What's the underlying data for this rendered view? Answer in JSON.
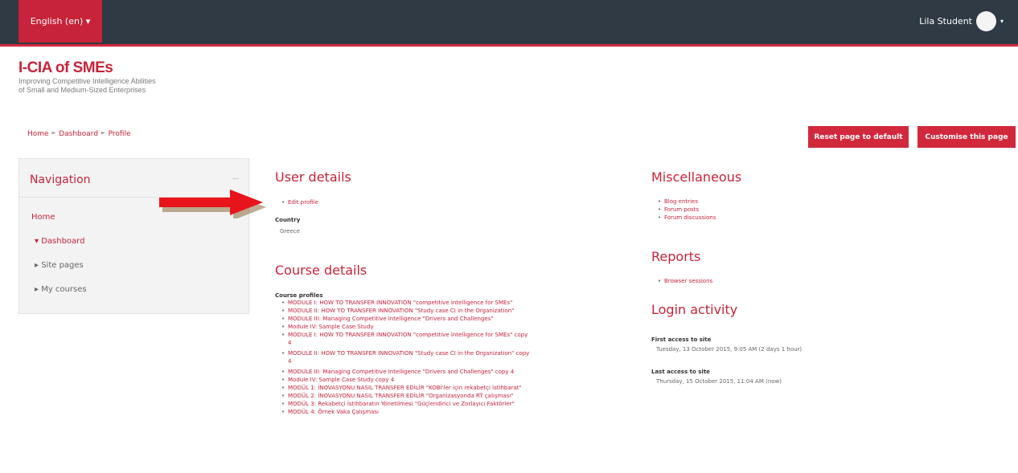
{
  "topbar": {
    "language": "English (en) ▾",
    "user_name": "Lila Student",
    "caret": "▾"
  },
  "logo": {
    "title": "I-CIA of SMEs",
    "subtitle_line1": "Improving Competitive Intelligence Abilities",
    "subtitle_line2": "of Small and Medium-Sized Enterprises"
  },
  "breadcrumb": [
    "Home",
    "►",
    "Dashboard",
    "►",
    "Profile"
  ],
  "buttons": {
    "reset": "Reset page to default",
    "customise": "Customise this page"
  },
  "navigation": {
    "title": "Navigation",
    "items": [
      "Home",
      "▾ Dashboard",
      "▸ Site pages",
      "▸ My courses"
    ]
  },
  "user_details": {
    "title": "User details",
    "edit_profile": "Edit profile",
    "country_label": "Country",
    "country_value": "Greece"
  },
  "course_details": {
    "title": "Course details",
    "profiles_label": "Course profiles",
    "courses": [
      "MODULE I: HOW TO TRANSFER INNOVATION \"competitive intelligence for SMEs\"",
      "MODULE II: HOW TO TRANSFER INNOVATION \"Study case CI in the Organization\"",
      "MODULE III: Managing Competitive Intelligence \"Drivers and Challenges\"",
      "Module IV: Sample Case Study",
      "MODULE I: HOW TO TRANSFER INNOVATION \"competitive intelligence for SMEs\" copy",
      "MODULE II: HOW TO TRANSFER INNOVATION \"Study case CI in the Organization\" copy",
      "MODULE III: Managing Competitive Intelligence \"Drivers and Challenges\" copy 4",
      "Module IV: Sample Case Study copy 4",
      "MODÜL 1: İNOVASYONU NASIL TRANSFER EDİLİR \"KOBİ'ler için rekabetçi istihbarat\"",
      "MODÜL 2: İNOVASYONU NASIL TRANSFER EDİLİR \"Organizasyonda RT çalışması\"",
      "MODÜL 3: Rekabetçi İstihbaratın Yönetilmesi \"Güçlendirici ve Zorlayıcı Faktörler\"",
      "MODÜL 4: Örnek Vaka Çalışması"
    ],
    "copy_suffix": "4"
  },
  "miscellaneous": {
    "title": "Miscellaneous",
    "items": [
      "Blog entries",
      "Forum posts",
      "Forum discussions"
    ]
  },
  "reports": {
    "title": "Reports",
    "items": [
      "Browser sessions"
    ]
  },
  "login_activity": {
    "title": "Login activity",
    "first_label": "First access to site",
    "first_value": "Tuesday, 13 October 2015, 9:05 AM  (2 days 1 hour)",
    "last_label": "Last access to site",
    "last_value": "Thursday, 15 October 2015, 11:04 AM  (now)"
  },
  "colors": {
    "accent": "#d2283c",
    "topbar": "#2f3a44",
    "arrow": "#e8141c"
  }
}
